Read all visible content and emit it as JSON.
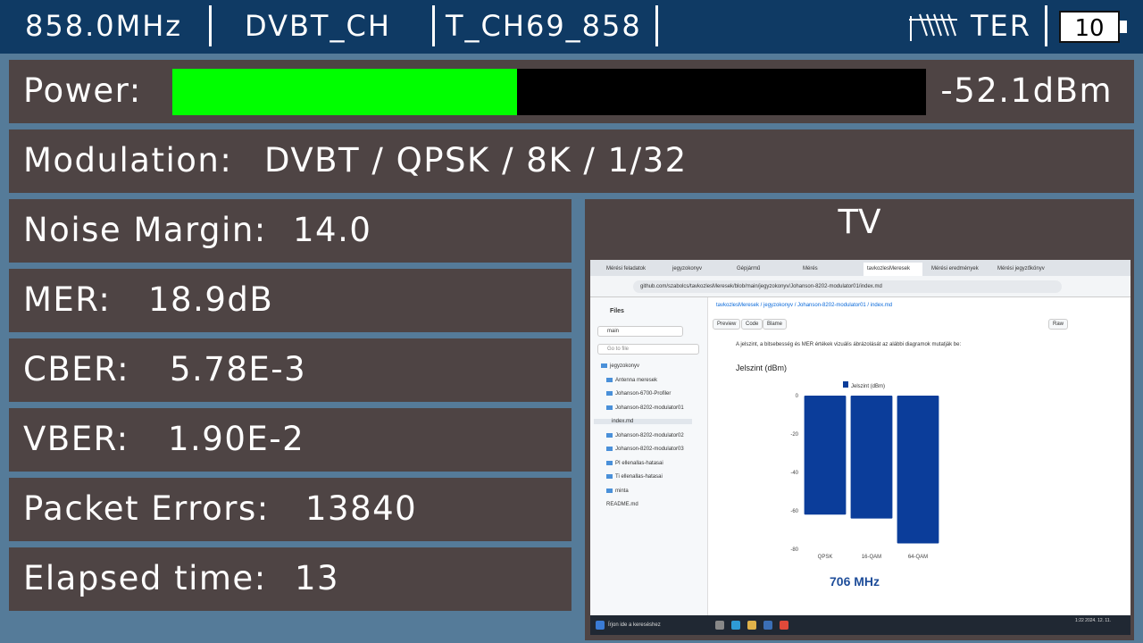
{
  "topbar": {
    "frequency": "858.0MHz",
    "standard": "DVBT_CH",
    "channel": "T_CH69_858",
    "antenna_icon": "antenna-icon",
    "band": "TER",
    "battery_icon": "battery-icon",
    "battery_value": "10"
  },
  "power": {
    "label": "Power:",
    "value": "-52.1dBm",
    "level_fraction": 0.457,
    "fill_color": "#00ff00"
  },
  "modulation": {
    "label": "Modulation:",
    "value": "DVBT / QPSK / 8K / 1/32"
  },
  "noise_margin": {
    "label": "Noise Margin:",
    "value": "14.0"
  },
  "mer": {
    "label": "MER:",
    "value": "18.9dB"
  },
  "cber": {
    "label": "CBER:",
    "value": "5.78E-3"
  },
  "vber": {
    "label": "VBER:",
    "value": "1.90E-2"
  },
  "packet_errors": {
    "label": "Packet Errors:",
    "value": "13840"
  },
  "elapsed_time": {
    "label": "Elapsed time:",
    "value": "13"
  },
  "tv": {
    "title": "TV",
    "screenshot": {
      "tabs": [
        "Mérési feladatok",
        "jegyzokonyv",
        "Gépjármű",
        "Mérés",
        "tavkozlesMeresek",
        "Mérési eredmények",
        "Mérési jegyzőkönyv"
      ],
      "url": "github.com/szabolcs/tavkozlesMeresek/blob/main/jegyzokonyv/Johanson-8202-modulator01/index.md",
      "sidebar": {
        "title": "Files",
        "branch": "main",
        "goto_placeholder": "Go to file",
        "items": [
          "jegyzokonyv",
          "Antenna meresek",
          "Johanson-6700-Profiler",
          "Johanson-8202-modulator01",
          "index.md",
          "Johanson-8202-modulator02",
          "Johanson-8202-modulator03",
          "PI ellenallas-hatasai",
          "Ti ellenallas-hatasai",
          "minta",
          "README.md"
        ]
      },
      "breadcrumb": "tavkozlesMeresek / jegyzokonyv / Johanson-8202-modulator01 / index.md",
      "toolbar": [
        "Preview",
        "Code",
        "Blame"
      ],
      "raw_label": "Raw",
      "intro_text": "A jelszint, a bitsebesség és MER értékek vizuális ábrázolását az alábbi diagramok mutatják be:",
      "chart_title": "Jelszint (dBm)",
      "freq_caption": "706 MHz",
      "taskbar_search": "Írjon ide a kereséshez",
      "taskbar_clock": "1:22\n2024. 12. 11."
    }
  },
  "chart_data": {
    "type": "bar",
    "title": "Jelszint (dBm)",
    "categories": [
      "QPSK",
      "16-QAM",
      "64-QAM"
    ],
    "series": [
      {
        "name": "Jelszint (dBm)",
        "values": [
          -62,
          -64,
          -77
        ]
      }
    ],
    "yticks": [
      "0",
      "-20",
      "-40",
      "-60",
      "-80"
    ],
    "ylim": [
      -80,
      0
    ],
    "legend": "top",
    "color": "#0b3d9a"
  }
}
